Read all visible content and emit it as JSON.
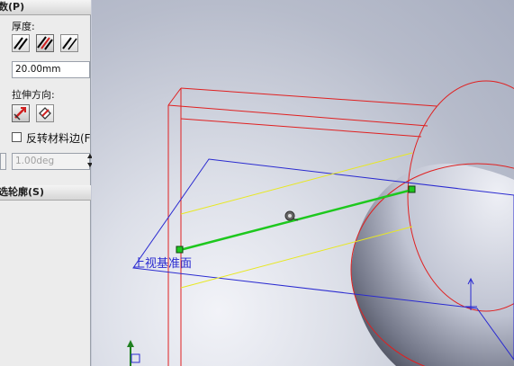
{
  "panel": {
    "section1_title": "数(P)",
    "thickness_label": "厚度:",
    "depth_value": "20.00mm",
    "direction_label": "拉伸方向:",
    "flip_side_label": "反转材料边(F",
    "draft_value": "1.00deg",
    "section2_title": "选轮廓(S)"
  },
  "viewport": {
    "plane_label": "上视基准面"
  },
  "colors": {
    "sketch_plane": "#2a2ad0",
    "preview_edges": "#e02020",
    "sketch_line": "#1ec81e",
    "offset_lines": "#e8e820"
  },
  "icons": [
    "thickness-one-side-icon",
    "thickness-mid-plane-icon",
    "thickness-two-side-icon",
    "reverse-direction-icon",
    "direction-vector-icon",
    "spin-arrows-icon",
    "coordinate-triad-icon",
    "origin-axis-icon",
    "midpoint-inference-icon"
  ]
}
